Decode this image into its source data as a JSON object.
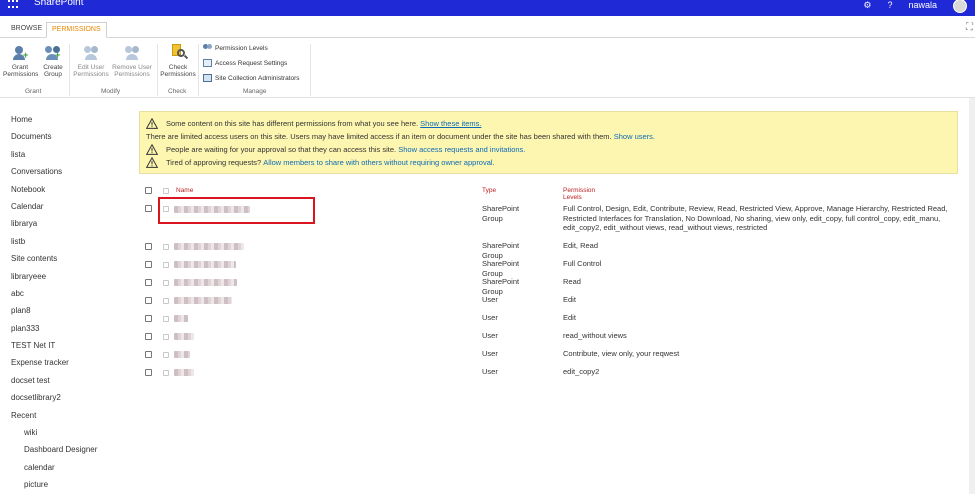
{
  "suitebar": {
    "brand": "SharePoint",
    "settings_icon": "gear-icon",
    "help_icon": "question-icon",
    "user_name": "nawala"
  },
  "ribbon": {
    "tabs": [
      "BROWSE",
      "PERMISSIONS"
    ],
    "active_tab": "PERMISSIONS",
    "buttons": {
      "grant_permissions": "Grant Permissions",
      "create_group": "Create Group",
      "edit_user_permissions": "Edit User Permissions",
      "remove_user_permissions": "Remove User Permissions",
      "check_permissions": "Check Permissions"
    },
    "manage_commands": [
      "Permission Levels",
      "Access Request Settings",
      "Site Collection Administrators"
    ],
    "groups": [
      "Grant",
      "Modify",
      "Check",
      "Manage"
    ]
  },
  "leftnav": {
    "items": [
      "Home",
      "Documents",
      "lista",
      "Conversations",
      "Notebook",
      "Calendar",
      "librarya",
      "listb",
      "Site contents",
      "libraryeee",
      "abc",
      "plan8",
      "plan333",
      "TEST Net IT",
      "Expense tracker",
      "docset test",
      "docsetlibrary2",
      "Recent"
    ],
    "recent_items": [
      "wiki",
      "Dashboard Designer",
      "calendar",
      "picture"
    ]
  },
  "banner": {
    "line1_text": "Some content on this site has different permissions from what you see here.",
    "line1_link": "Show these items.",
    "line2_text": "There are limited access users on this site. Users may have limited access if an item or document under the site has been shared with them.",
    "line2_link": "Show users.",
    "line3_text": "People are waiting for your approval so that they can access this site.",
    "line3_link": "Show access requests and invitations.",
    "line4_text": "Tired of approving requests?",
    "line4_link": "Allow members to share with others without requiring owner approval."
  },
  "table": {
    "headers": {
      "name": "Name",
      "type": "Type",
      "permission_levels": "Permission Levels"
    },
    "rows": [
      {
        "type": "SharePoint Group",
        "permissions": "Full Control, Design, Edit, Contribute, Review, Read, Restricted View, Approve, Manage Hierarchy, Restricted Read, Restricted Interfaces for Translation, No Download, No sharing, view only, edit_copy, full control_copy, edit_manu, edit_copy2, edit_without views, read_without views, restricted"
      },
      {
        "type": "SharePoint Group",
        "permissions": "Edit, Read"
      },
      {
        "type": "SharePoint Group",
        "permissions": "Full Control"
      },
      {
        "type": "SharePoint Group",
        "permissions": "Read"
      },
      {
        "type": "User",
        "permissions": "Edit"
      },
      {
        "type": "User",
        "permissions": "Edit"
      },
      {
        "type": "User",
        "permissions": "read_without views"
      },
      {
        "type": "User",
        "permissions": "Contribute, view only, your reqwest"
      },
      {
        "type": "User",
        "permissions": "edit_copy2"
      }
    ]
  },
  "colors": {
    "suitebar": "#1f29d6",
    "active_tab": "#e88700",
    "banner_bg": "#fdf6b0",
    "link": "#0b6ab8",
    "highlight_box": "#d9161f",
    "header_text": "#b22222"
  }
}
